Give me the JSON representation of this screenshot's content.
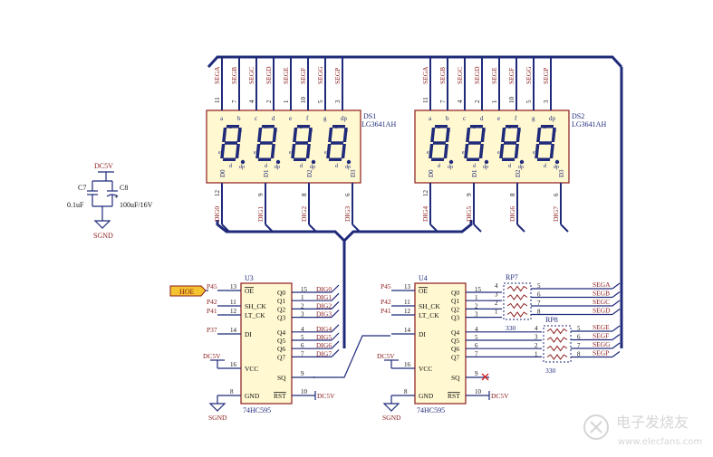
{
  "displays": [
    {
      "ref": "DS1",
      "part": "LG3641AH",
      "top_pins": [
        {
          "net": "SEGA",
          "num": "11",
          "seg": "a"
        },
        {
          "net": "SEGB",
          "num": "7",
          "seg": "b"
        },
        {
          "net": "SEGC",
          "num": "4",
          "seg": "c"
        },
        {
          "net": "SEGD",
          "num": "2",
          "seg": "d"
        },
        {
          "net": "SEGE",
          "num": "1",
          "seg": "e"
        },
        {
          "net": "SEGF",
          "num": "10",
          "seg": "f"
        },
        {
          "net": "SEGG",
          "num": "5",
          "seg": "g"
        },
        {
          "net": "SEGP",
          "num": "3",
          "seg": "dp"
        }
      ],
      "bottom_pins": [
        {
          "net": "DIG0",
          "num": "12",
          "label": "D0"
        },
        {
          "net": "DIG1",
          "num": "9",
          "label": "D1"
        },
        {
          "net": "DIG2",
          "num": "8",
          "label": "D2"
        },
        {
          "net": "DIG3",
          "num": "6",
          "label": "D3"
        }
      ]
    },
    {
      "ref": "DS2",
      "part": "LG3641AH",
      "top_pins": [
        {
          "net": "SEGA",
          "num": "11",
          "seg": "a"
        },
        {
          "net": "SEGB",
          "num": "7",
          "seg": "b"
        },
        {
          "net": "SEGC",
          "num": "4",
          "seg": "c"
        },
        {
          "net": "SEGD",
          "num": "2",
          "seg": "d"
        },
        {
          "net": "SEGE",
          "num": "1",
          "seg": "e"
        },
        {
          "net": "SEGF",
          "num": "10",
          "seg": "f"
        },
        {
          "net": "SEGG",
          "num": "5",
          "seg": "g"
        },
        {
          "net": "SEGP",
          "num": "3",
          "seg": "dp"
        }
      ],
      "bottom_pins": [
        {
          "net": "DIG4",
          "num": "12",
          "label": "D0"
        },
        {
          "net": "DIG5",
          "num": "9",
          "label": "D1"
        },
        {
          "net": "DIG6",
          "num": "8",
          "label": "D2"
        },
        {
          "net": "DIG7",
          "num": "6",
          "label": "D3"
        }
      ]
    }
  ],
  "caps": {
    "supply": "DC5V",
    "c7_ref": "C7",
    "c7_value": "0.1uF",
    "c8_ref": "C8",
    "c8_value": "100uF/16V",
    "ground": "SGND",
    "plus": "+"
  },
  "hoe_label": "HOE",
  "chips": [
    {
      "ref": "U3",
      "part": "74HC595",
      "left_pins": [
        {
          "net": "P45",
          "num": "13",
          "name": "OE",
          "bar": true
        },
        {
          "net": "P42",
          "num": "11",
          "name": "SH_CK",
          "bar": false
        },
        {
          "net": "P41",
          "num": "12",
          "name": "LT_CK",
          "bar": false
        },
        {
          "net": "P37",
          "num": "14",
          "name": "DI",
          "bar": false
        },
        {
          "net": "DC5V",
          "num": "16",
          "name": "VCC",
          "bar": false
        },
        {
          "net": "SGND",
          "num": "8",
          "name": "GND",
          "bar": false
        }
      ],
      "right_pins": [
        {
          "num": "15",
          "name": "Q0",
          "net": "DIG0"
        },
        {
          "num": "1",
          "name": "Q1",
          "net": "DIG1"
        },
        {
          "num": "2",
          "name": "Q2",
          "net": "DIG2"
        },
        {
          "num": "3",
          "name": "Q3",
          "net": "DIG3"
        },
        {
          "num": "4",
          "name": "Q4",
          "net": "DIG4"
        },
        {
          "num": "5",
          "name": "Q5",
          "net": "DIG5"
        },
        {
          "num": "6",
          "name": "Q6",
          "net": "DIG6"
        },
        {
          "num": "7",
          "name": "Q7",
          "net": "DIG7"
        }
      ],
      "sq": {
        "name": "SQ",
        "num": "9"
      },
      "rst": {
        "name": "RST",
        "num": "10",
        "net": "DC5V"
      }
    },
    {
      "ref": "U4",
      "part": "74HC595",
      "left_pins": [
        {
          "net": "P45",
          "num": "13",
          "name": "OE",
          "bar": true
        },
        {
          "net": "P42",
          "num": "11",
          "name": "SH_CK",
          "bar": false
        },
        {
          "net": "P41",
          "num": "12",
          "name": "LT_CK",
          "bar": false
        },
        {
          "net": "",
          "num": "14",
          "name": "DI",
          "bar": false
        },
        {
          "net": "DC5V",
          "num": "16",
          "name": "VCC",
          "bar": false
        },
        {
          "net": "SGND",
          "num": "8",
          "name": "GND",
          "bar": false
        }
      ],
      "right_pins": [
        {
          "num": "15",
          "name": "Q0"
        },
        {
          "num": "1",
          "name": "Q1"
        },
        {
          "num": "2",
          "name": "Q2"
        },
        {
          "num": "3",
          "name": "Q3"
        },
        {
          "num": "4",
          "name": "Q4"
        },
        {
          "num": "5",
          "name": "Q5"
        },
        {
          "num": "6",
          "name": "Q6"
        },
        {
          "num": "7",
          "name": "Q7"
        }
      ],
      "sq": {
        "name": "SQ",
        "num": "9"
      },
      "rst": {
        "name": "RST",
        "num": "10",
        "net": "DC5V"
      }
    }
  ],
  "resistor_arrays": [
    {
      "ref": "RP7",
      "value": "330",
      "in_pins": [
        "4",
        "3",
        "2",
        "1"
      ],
      "out_pins": [
        "5",
        "6",
        "7",
        "8"
      ]
    },
    {
      "ref": "RP8",
      "value": "330",
      "in_pins": [
        "4",
        "3",
        "2",
        "1"
      ],
      "out_pins": [
        "5",
        "6",
        "7",
        "8"
      ]
    }
  ],
  "seg_nets": [
    "SEGA",
    "SEGB",
    "SEGC",
    "SEGD",
    "SEGE",
    "SEGF",
    "SEGG",
    "SEGP"
  ],
  "watermark": {
    "cn": "电子发烧友",
    "url": "www.elecfans.com"
  }
}
